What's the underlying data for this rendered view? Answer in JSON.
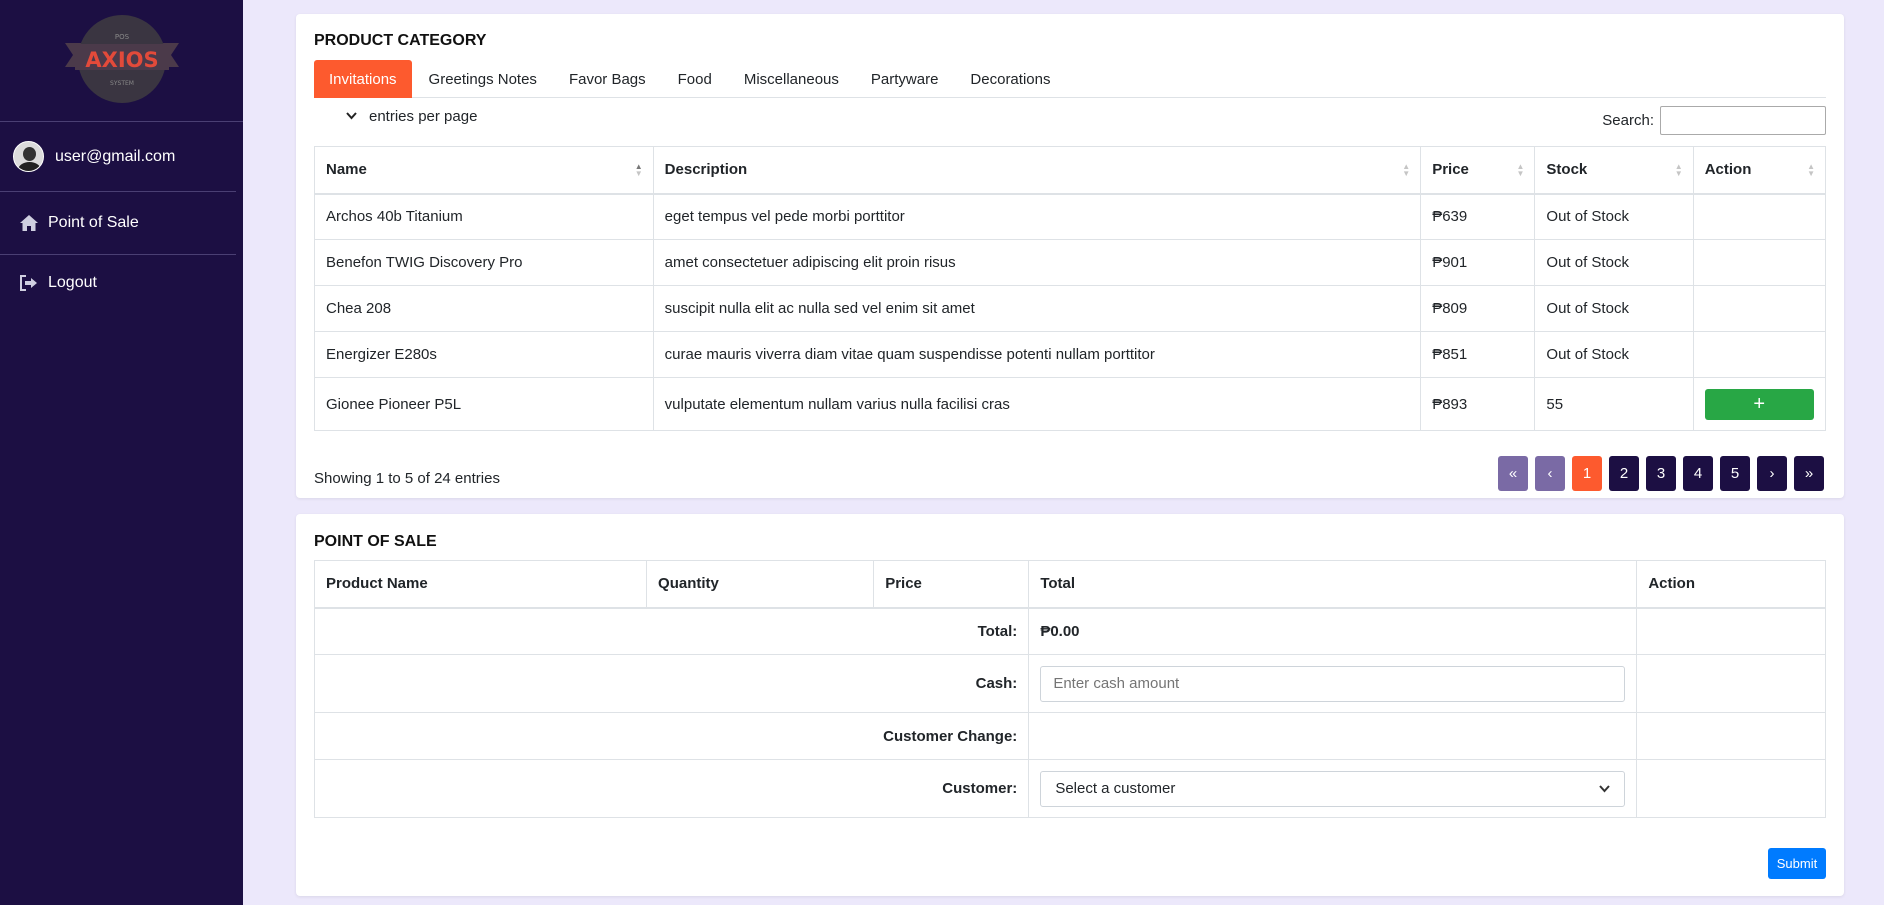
{
  "sidebar": {
    "logo": {
      "top_text": "POS",
      "main_text": "AXIOS",
      "bottom_text": "SYSTEM"
    },
    "user_email": "user@gmail.com",
    "nav": [
      {
        "label": "Point of Sale",
        "icon": "home-icon"
      },
      {
        "label": "Logout",
        "icon": "logout-icon"
      }
    ]
  },
  "product_category": {
    "title": "PRODUCT CATEGORY",
    "tabs": [
      "Invitations",
      "Greetings Notes",
      "Favor Bags",
      "Food",
      "Miscellaneous",
      "Partyware",
      "Decorations"
    ],
    "active_tab": "Invitations",
    "entries_label": "entries per page",
    "search_label": "Search:",
    "columns": [
      "Name",
      "Description",
      "Price",
      "Stock",
      "Action"
    ],
    "rows": [
      {
        "name": "Archos 40b Titanium",
        "description": "eget tempus vel pede morbi porttitor",
        "price": "₱639",
        "stock": "Out of Stock"
      },
      {
        "name": "Benefon TWIG Discovery Pro",
        "description": "amet consectetuer adipiscing elit proin risus",
        "price": "₱901",
        "stock": "Out of Stock"
      },
      {
        "name": "Chea 208",
        "description": "suscipit nulla elit ac nulla sed vel enim sit amet",
        "price": "₱809",
        "stock": "Out of Stock"
      },
      {
        "name": "Energizer E280s",
        "description": "curae mauris viverra diam vitae quam suspendisse potenti nullam porttitor",
        "price": "₱851",
        "stock": "Out of Stock"
      },
      {
        "name": "Gionee Pioneer P5L",
        "description": "vulputate elementum nullam varius nulla facilisi cras",
        "price": "₱893",
        "stock": "55"
      }
    ],
    "add_button_label": "+",
    "showing": "Showing 1 to 5 of 24 entries",
    "pagination": {
      "first": "«",
      "prev": "‹",
      "pages": [
        "1",
        "2",
        "3",
        "4",
        "5"
      ],
      "current": "1",
      "next": "›",
      "last": "»"
    }
  },
  "point_of_sale": {
    "title": "POINT OF SALE",
    "columns": [
      "Product Name",
      "Quantity",
      "Price",
      "Total",
      "Action"
    ],
    "total_label": "Total:",
    "total_value": "₱0.00",
    "cash_label": "Cash:",
    "cash_placeholder": "Enter cash amount",
    "change_label": "Customer Change:",
    "customer_label": "Customer:",
    "customer_select": "Select a customer",
    "submit_label": "Submit"
  },
  "colors": {
    "sidebar_bg": "#1c0f43",
    "accent": "#fd5a2e",
    "success": "#28a745",
    "primary": "#007bff",
    "page_bg": "#ece8fb"
  }
}
